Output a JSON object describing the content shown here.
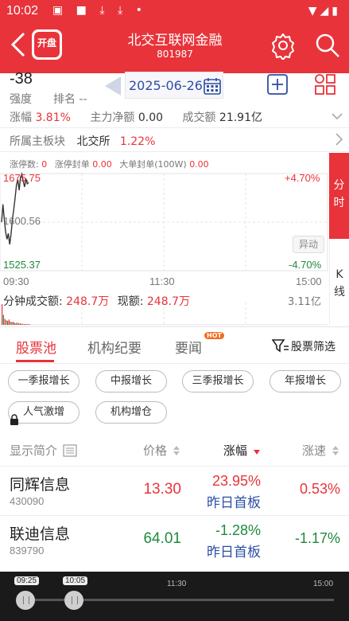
{
  "status_bar": {
    "time": "10:02"
  },
  "header": {
    "logo_text": "开盘",
    "title": "北交互联网金融",
    "code": "801987"
  },
  "summary": {
    "strength_value": "-38",
    "strength_label": "强度",
    "rank_label": "排名 --",
    "date": "2025-06-26",
    "change_label": "涨幅",
    "change_value": "3.81%",
    "net_label": "主力净额",
    "net_value": "0.00",
    "turnover_label": "成交额",
    "turnover_value": "21.91亿",
    "sector_label": "所属主板块",
    "sector_name": "北交所",
    "sector_change": "1.22%"
  },
  "limit_info": {
    "limit_up_label": "涨停数:",
    "limit_up_value": "0",
    "seal_label": "涨停封单",
    "seal_value": "0.00",
    "big_seal_label": "大单封单(100W)",
    "big_seal_value": "0.00"
  },
  "chart_data": {
    "type": "line",
    "y_labels": {
      "top": "1675.75",
      "mid": "1600.56",
      "bottom": "1525.37"
    },
    "pct_labels": {
      "top": "+4.70%",
      "bottom": "-4.70%"
    },
    "x_labels": [
      "09:30",
      "11:30",
      "15:00"
    ],
    "ylim": [
      1525.37,
      1675.75
    ],
    "series": [
      {
        "points": [
          [
            "09:30",
            1600.56
          ],
          [
            "09:31",
            1628
          ],
          [
            "09:32",
            1605
          ],
          [
            "09:33",
            1585
          ],
          [
            "09:34",
            1574
          ],
          [
            "09:35",
            1583
          ],
          [
            "09:36",
            1566
          ],
          [
            "09:37",
            1582
          ],
          [
            "09:38",
            1605
          ],
          [
            "09:39",
            1620
          ],
          [
            "09:40",
            1638
          ],
          [
            "09:41",
            1658
          ],
          [
            "09:42",
            1666
          ],
          [
            "09:43",
            1650
          ],
          [
            "09:44",
            1670
          ],
          [
            "09:45",
            1675
          ],
          [
            "09:46",
            1664
          ],
          [
            "09:47",
            1655
          ],
          [
            "09:48",
            1668
          ],
          [
            "09:49",
            1660
          ],
          [
            "09:50",
            1662
          ]
        ]
      }
    ],
    "volume_label": "分钟成交额:",
    "volume_value": "248.7万",
    "current_volume_label": "现额:",
    "current_volume_value": "248.7万",
    "volume_max": "3.11亿",
    "volume_bars": [
      3.11,
      1.5,
      0.9,
      0.7,
      0.6,
      0.8,
      0.5,
      0.4,
      0.45,
      0.3,
      0.25,
      0.35,
      0.2,
      0.22,
      0.18,
      0.15,
      0.12,
      0.1,
      0.14,
      0.09,
      0.08
    ]
  },
  "side_tabs": {
    "intraday": "分时",
    "kline": "K线"
  },
  "abnormal_label": "异动",
  "tabs": [
    "股票池",
    "机构纪要",
    "要闻"
  ],
  "hot_badge": "HOT",
  "filter_label": "股票筛选",
  "tags": [
    "一季报增长",
    "中报增长",
    "三季报增长",
    "年报增长",
    "人气激增",
    "机构增仓"
  ],
  "table": {
    "headers": [
      "显示简介",
      "价格",
      "涨幅",
      "涨速"
    ],
    "rows": [
      {
        "name": "同辉信息",
        "code": "430090",
        "price": "13.30",
        "change": "23.95%",
        "tag": "昨日首板",
        "speed": "0.53%"
      },
      {
        "name": "联迪信息",
        "code": "839790",
        "price": "64.01",
        "change": "-1.28%",
        "tag": "昨日首板",
        "speed": "-1.17%"
      }
    ]
  },
  "timeline": {
    "start": "09:25",
    "current": "10:05",
    "mid": "11:30",
    "end": "15:00"
  },
  "colors": {
    "accent": "#e8333a",
    "up": "#e8333a",
    "down": "#1e8a3c",
    "link": "#2d4fa3"
  }
}
